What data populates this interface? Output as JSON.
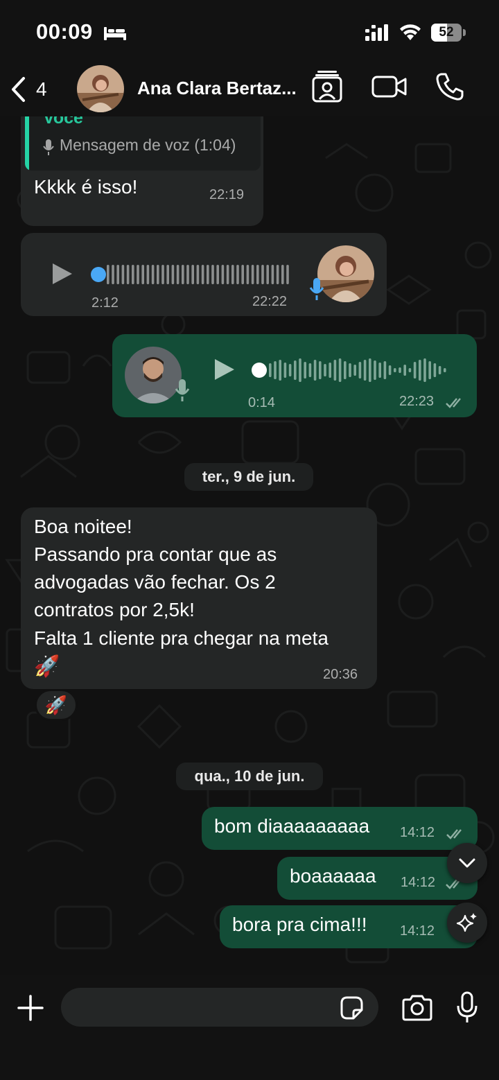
{
  "status_bar": {
    "time": "00:09",
    "battery": "52",
    "battery_level": 0.52
  },
  "header": {
    "back_count": "4",
    "contact_name": "Ana Clara Bertaz..."
  },
  "messages": {
    "m1": {
      "quote_author": "Você",
      "quote_text": "Mensagem de voz (1:04)",
      "text": "Kkkk é isso!",
      "time": "22:19"
    },
    "m2": {
      "duration": "2:12",
      "time": "22:22",
      "played": 0
    },
    "m3": {
      "duration": "0:14",
      "time": "22:23",
      "played": 0
    },
    "date1": "ter., 9 de jun.",
    "m4": {
      "line1": "Boa noitee!",
      "line2": "Passando pra contar que as",
      "line3": "advogadas vão fechar. Os 2",
      "line4": "contratos por 2,5k!",
      "line5": "Falta 1 cliente pra chegar na meta",
      "emoji": "🚀",
      "time": "20:36",
      "reaction": "🚀"
    },
    "date2": "qua., 10 de jun.",
    "m5": {
      "text": "bom diaaaaaaaaa",
      "time": "14:12"
    },
    "m6": {
      "text": "boaaaaaa",
      "time": "14:12"
    },
    "m7": {
      "text": "bora pra cima!!!",
      "time": "14:12"
    }
  },
  "composer": {
    "placeholder": ""
  },
  "colors": {
    "incoming": "#242626",
    "outgoing": "#134d37",
    "accent": "#25d3a5",
    "voice_dot": "#4aa8f5",
    "tick": "#8fb0a3"
  },
  "icons": [
    "bed-icon",
    "signal-icon",
    "wifi-icon",
    "back-chevron-icon",
    "contacts-icon",
    "video-call-icon",
    "phone-icon",
    "play-icon",
    "mic-icon",
    "double-check-icon",
    "chevron-down-icon",
    "sparkle-icon",
    "plus-icon",
    "sticker-icon",
    "camera-icon"
  ]
}
